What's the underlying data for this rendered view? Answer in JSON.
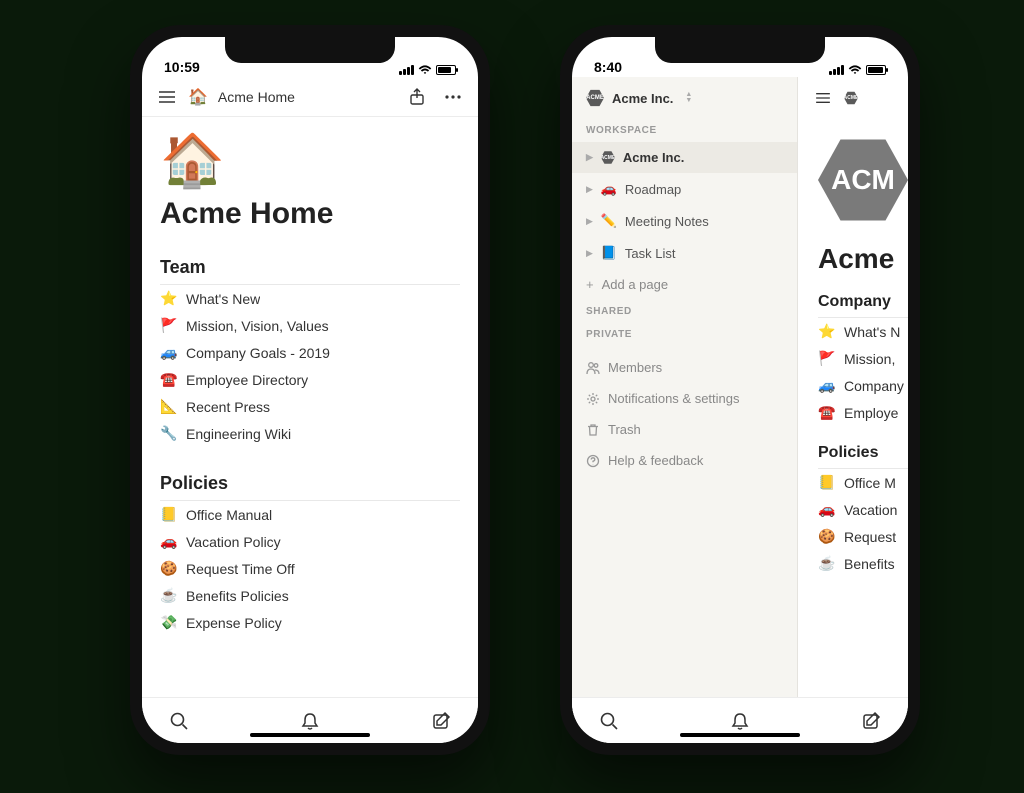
{
  "phone_left": {
    "status_time": "10:59",
    "nav": {
      "icon": "🏠",
      "title": "Acme Home"
    },
    "page": {
      "hero_icon": "🏠",
      "title": "Acme Home",
      "sections": [
        {
          "heading": "Team",
          "items": [
            {
              "icon": "⭐",
              "label": "What's New"
            },
            {
              "icon": "🚩",
              "label": "Mission, Vision, Values"
            },
            {
              "icon": "🚙",
              "label": "Company Goals - 2019"
            },
            {
              "icon": "☎️",
              "label": "Employee Directory"
            },
            {
              "icon": "📐",
              "label": "Recent Press"
            },
            {
              "icon": "🔧",
              "label": "Engineering Wiki"
            }
          ]
        },
        {
          "heading": "Policies",
          "items": [
            {
              "icon": "📒",
              "label": "Office Manual"
            },
            {
              "icon": "🚗",
              "label": "Vacation Policy"
            },
            {
              "icon": "🍪",
              "label": "Request Time Off"
            },
            {
              "icon": "☕",
              "label": "Benefits Policies"
            },
            {
              "icon": "💸",
              "label": "Expense Policy"
            }
          ]
        }
      ]
    }
  },
  "phone_right": {
    "status_time": "8:40",
    "sidebar": {
      "workspace_name": "Acme Inc.",
      "section_workspace_label": "WORKSPACE",
      "items": [
        {
          "icon_type": "badge",
          "label": "Acme Inc.",
          "active": true
        },
        {
          "icon": "🚗",
          "label": "Roadmap"
        },
        {
          "icon": "✏️",
          "label": "Meeting Notes"
        },
        {
          "icon": "📘",
          "label": "Task List"
        }
      ],
      "add_page_label": "Add a page",
      "section_shared_label": "SHARED",
      "section_private_label": "PRIVATE",
      "footer": [
        {
          "name": "members",
          "label": "Members"
        },
        {
          "name": "settings",
          "label": "Notifications & settings"
        },
        {
          "name": "trash",
          "label": "Trash"
        },
        {
          "name": "help",
          "label": "Help & feedback"
        }
      ]
    },
    "peek": {
      "title": "Acme",
      "section1": "Company",
      "rows1": [
        {
          "icon": "⭐",
          "label": "What's N"
        },
        {
          "icon": "🚩",
          "label": "Mission,"
        },
        {
          "icon": "🚙",
          "label": "Company"
        },
        {
          "icon": "☎️",
          "label": "Employe"
        }
      ],
      "section2": "Policies",
      "rows2": [
        {
          "icon": "📒",
          "label": "Office M"
        },
        {
          "icon": "🚗",
          "label": "Vacation"
        },
        {
          "icon": "🍪",
          "label": "Request"
        },
        {
          "icon": "☕",
          "label": "Benefits"
        }
      ]
    }
  }
}
